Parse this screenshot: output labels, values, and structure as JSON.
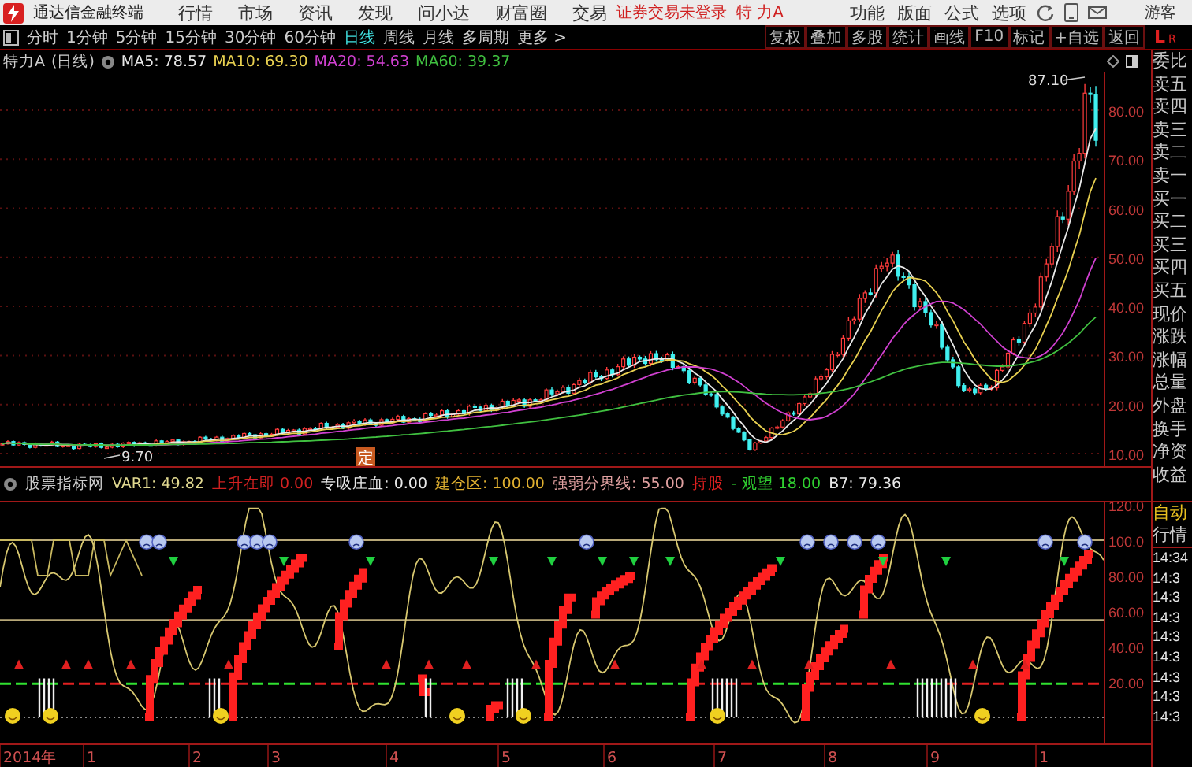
{
  "title_bar": {
    "app_name": "通达信金融终端",
    "menu": [
      "行情",
      "市场",
      "资讯",
      "发现",
      "问小达",
      "财富圈",
      "交易"
    ],
    "notice": "证券交易未登录",
    "stock": "特 力A",
    "right_menu": [
      "功能",
      "版面",
      "公式",
      "选项"
    ],
    "user": "游客"
  },
  "toolbar": {
    "periods": [
      {
        "label": "分时",
        "selected": false
      },
      {
        "label": "1分钟",
        "selected": false
      },
      {
        "label": "5分钟",
        "selected": false
      },
      {
        "label": "15分钟",
        "selected": false
      },
      {
        "label": "30分钟",
        "selected": false
      },
      {
        "label": "60分钟",
        "selected": false
      },
      {
        "label": "日线",
        "selected": true
      },
      {
        "label": "周线",
        "selected": false
      },
      {
        "label": "月线",
        "selected": false
      },
      {
        "label": "多周期",
        "selected": false
      }
    ],
    "more": "更多 >",
    "tools": [
      "复权",
      "叠加",
      "多股",
      "统计",
      "画线",
      "F10",
      "标记",
      "+自选",
      "返回"
    ],
    "level_l": "L",
    "level_r": "R"
  },
  "info": {
    "stock": "特力A",
    "period": "(日线)",
    "ma": [
      {
        "label": "MA5: 78.57",
        "color": "#e8e8e8"
      },
      {
        "label": "MA10: 69.30",
        "color": "#e8d050"
      },
      {
        "label": "MA20: 54.63",
        "color": "#d040d0"
      },
      {
        "label": "MA60: 39.37",
        "color": "#40c040"
      }
    ]
  },
  "price_chart": {
    "axis": [
      "80.00",
      "70.00",
      "60.00",
      "50.00",
      "40.00",
      "30.00",
      "20.00",
      "10.00"
    ],
    "high_label": "87.10",
    "low_label": "9.70",
    "marker": "定"
  },
  "quote_panel": {
    "fields": [
      "委比",
      "卖五",
      "卖四",
      "卖三",
      "卖二",
      "卖一",
      "买一",
      "买二",
      "买三",
      "买四",
      "买五",
      "现价",
      "涨跌",
      "涨幅",
      "总量",
      "外盘",
      "换手",
      "净资",
      "收益"
    ],
    "auto": "自动",
    "quote": "行情",
    "times": [
      "14:34",
      "14:3",
      "14:3",
      "14:3",
      "14:3",
      "14:3",
      "14:3",
      "14:3",
      "14:3"
    ]
  },
  "indicator": {
    "name": "股票指标网",
    "values": [
      {
        "text": "VAR1: 49.82",
        "color": "#e0d890"
      },
      {
        "text": "上升在即 0.00",
        "color": "#d02020"
      },
      {
        "text": "专吸庄血: 0.00",
        "color": "#e8e8e8"
      },
      {
        "text": "建仓区: 100.00",
        "color": "#e0b030"
      },
      {
        "text": "强弱分界线: 55.00",
        "color": "#e0a0a0"
      },
      {
        "text": "持股",
        "color": "#e02020"
      },
      {
        "text": "- 观望 18.00",
        "color": "#30d030"
      },
      {
        "text": "B7: 79.36",
        "color": "#e8e8e8"
      }
    ],
    "axis": [
      "120.0",
      "100.0",
      "80.00",
      "60.00",
      "40.00",
      "20.00"
    ]
  },
  "date_axis": [
    "2014年",
    "1",
    "2",
    "3",
    "4",
    "5",
    "6",
    "7",
    "8",
    "9",
    "1"
  ]
}
